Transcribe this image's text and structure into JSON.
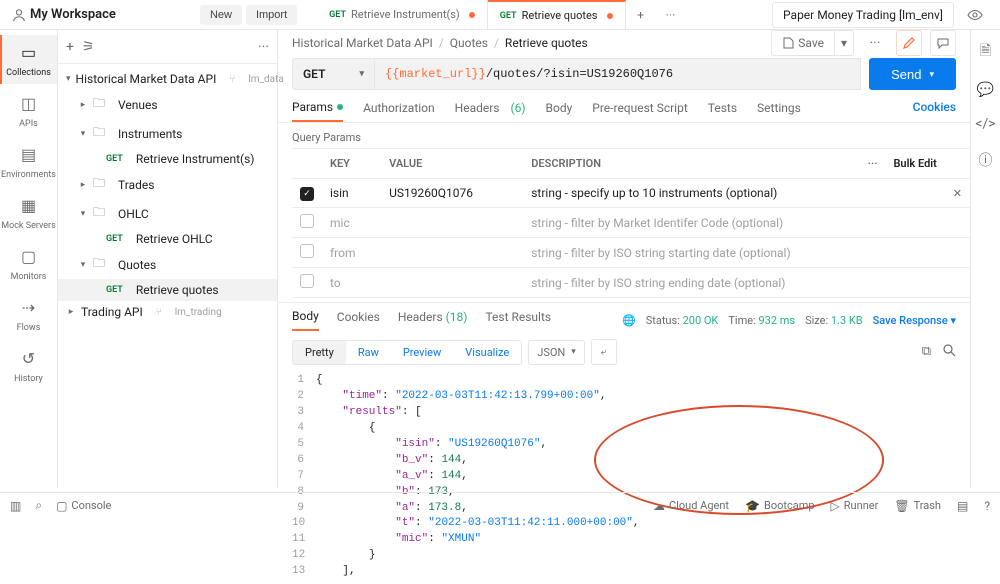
{
  "workspace": {
    "title": "My Workspace",
    "new": "New",
    "import": "Import"
  },
  "tabs": [
    {
      "method": "GET",
      "label": "Retrieve Instrument(s)",
      "dirty": true
    },
    {
      "method": "GET",
      "label": "Retrieve quotes",
      "dirty": true
    }
  ],
  "env": {
    "name": "Paper Money Trading [lm_env]"
  },
  "rail": {
    "collections": "Collections",
    "apis": "APIs",
    "envs": "Environments",
    "mock": "Mock Servers",
    "monitors": "Monitors",
    "flows": "Flows",
    "history": "History"
  },
  "tree": {
    "root": "Historical Market Data API",
    "root_meta": "lm_data",
    "venues": "Venues",
    "instruments": "Instruments",
    "retrieve_inst": "Retrieve Instrument(s)",
    "trades": "Trades",
    "ohlc": "OHLC",
    "retrieve_ohlc": "Retrieve OHLC",
    "quotes": "Quotes",
    "retrieve_quotes": "Retrieve quotes",
    "trading": "Trading API",
    "trading_meta": "lm_trading"
  },
  "crumb": {
    "a": "Historical Market Data API",
    "b": "Quotes",
    "c": "Retrieve quotes",
    "save": "Save"
  },
  "req": {
    "method": "GET",
    "url_var": "{{market_url}}",
    "url_rest": "/quotes/?isin=US19260Q1076",
    "send": "Send"
  },
  "reqtabs": {
    "params": "Params",
    "auth": "Authorization",
    "headers": "Headers",
    "headers_n": "(6)",
    "body": "Body",
    "prereq": "Pre-request Script",
    "tests": "Tests",
    "settings": "Settings",
    "cookies": "Cookies"
  },
  "qp": {
    "label": "Query Params",
    "cols": {
      "key": "KEY",
      "value": "VALUE",
      "desc": "DESCRIPTION",
      "bulk": "Bulk Edit"
    },
    "rows": [
      {
        "on": true,
        "key": "isin",
        "value": "US19260Q1076",
        "desc": "string - specify up to 10 instruments (optional)"
      },
      {
        "on": false,
        "key": "mic",
        "value": "",
        "desc": "string - filter by Market Identifer Code (optional)"
      },
      {
        "on": false,
        "key": "from",
        "value": "",
        "desc": "string - filter by ISO string starting date (optional)"
      },
      {
        "on": false,
        "key": "to",
        "value": "",
        "desc": "string - filter by ISO string ending date (optional)"
      }
    ]
  },
  "resp": {
    "tabs": {
      "body": "Body",
      "cookies": "Cookies",
      "headers": "Headers",
      "headers_n": "(18)",
      "tests": "Test Results"
    },
    "status_l": "Status:",
    "status_v": "200 OK",
    "time_l": "Time:",
    "time_v": "932 ms",
    "size_l": "Size:",
    "size_v": "1.3 KB",
    "save": "Save Response",
    "view": {
      "pretty": "Pretty",
      "raw": "Raw",
      "preview": "Preview",
      "vis": "Visualize",
      "fmt": "JSON"
    },
    "json": {
      "time": "2022-03-03T11:42:13.799+00:00",
      "isin": "US19260Q1076",
      "b_v": 144,
      "a_v": 144,
      "b": 173.0,
      "a": 173.8,
      "t": "2022-03-03T11:42:11.000+00:00",
      "mic": "XMUN"
    }
  },
  "footer": {
    "console": "Console",
    "bootcamp": "Bootcamp",
    "runner": "Runner",
    "trash": "Trash",
    "cloud": "Cloud Agent"
  }
}
